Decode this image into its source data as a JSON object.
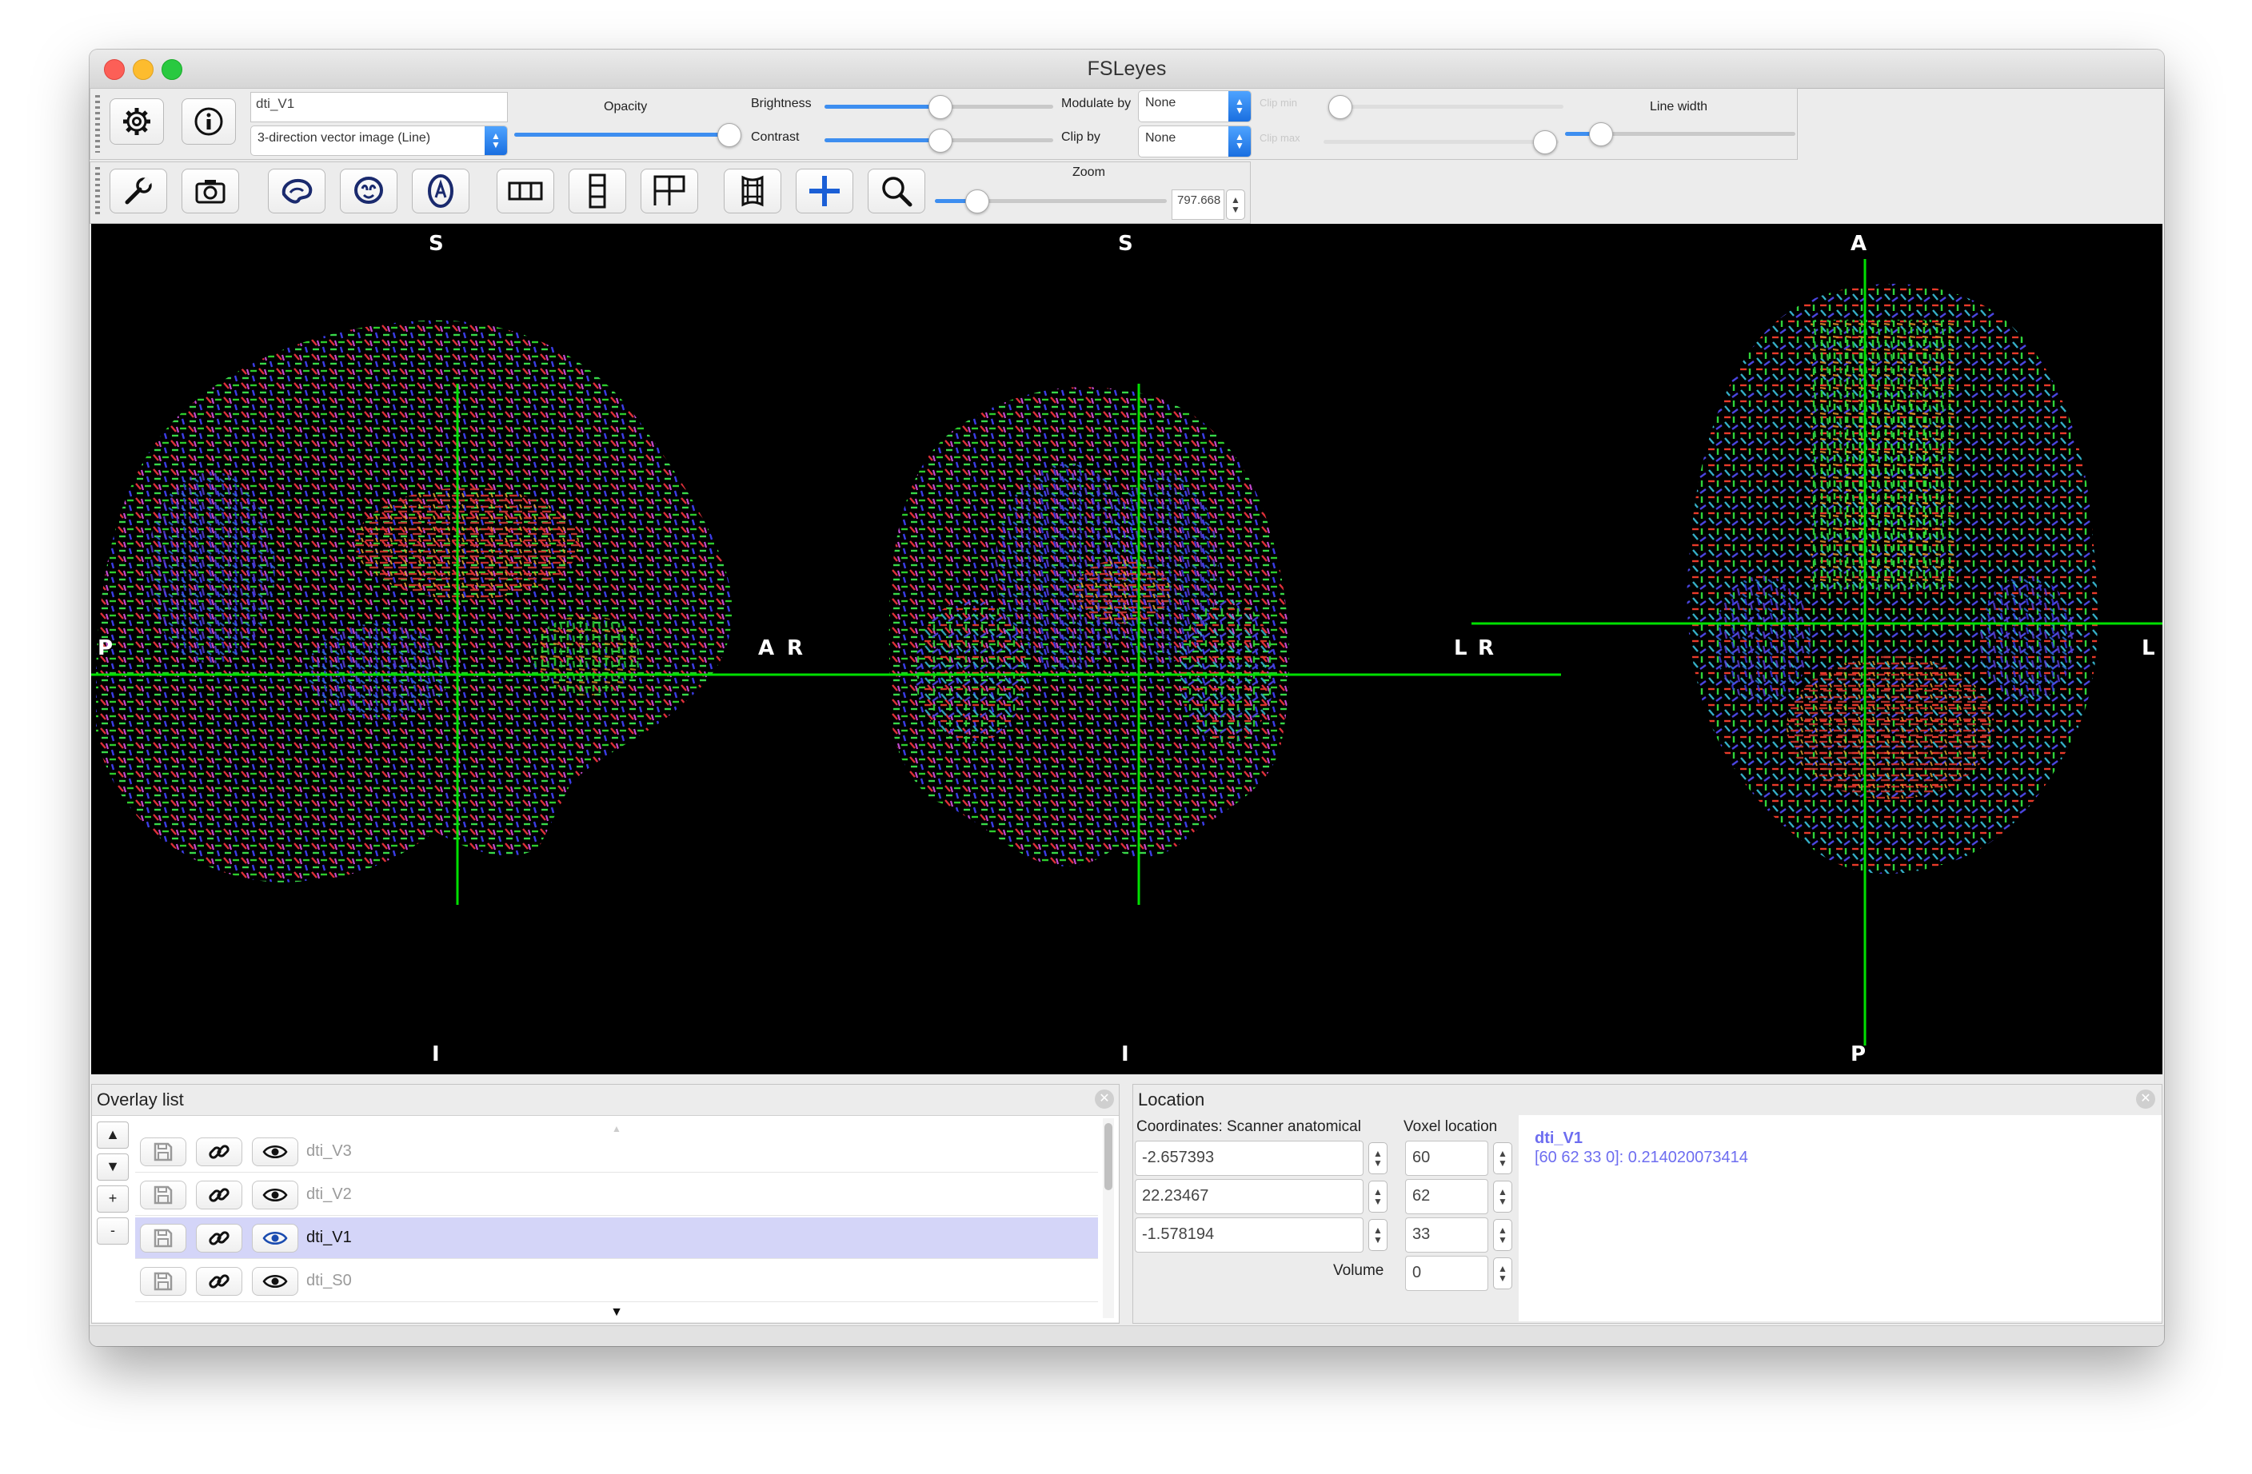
{
  "window": {
    "title": "FSLeyes"
  },
  "toolbar": {
    "overlay_name": "dti_V1",
    "display_type": "3-direction vector image (Line)",
    "opacity_label": "Opacity",
    "opacity_value": 0.95,
    "brightness_label": "Brightness",
    "brightness_value": 0.5,
    "contrast_label": "Contrast",
    "contrast_value": 0.5,
    "modulate_label": "Modulate by",
    "modulate_value": "None",
    "clip_label": "Clip by",
    "clip_value": "None",
    "clip_min_label": "Clip min",
    "clip_max_label": "Clip max",
    "line_width_label": "Line width",
    "line_width_value": 0.15,
    "zoom_label": "Zoom",
    "zoom_value": "797.668",
    "icons": [
      "gear-icon",
      "info-icon",
      "wrench-icon",
      "camera-icon",
      "sagittal-brain-icon",
      "coronal-brain-icon",
      "axial-brain-icon",
      "layout-horizontal-icon",
      "layout-vertical-icon",
      "layout-grid-icon",
      "movie-icon",
      "crosshair-icon",
      "zoom-icon"
    ]
  },
  "view": {
    "sagittal": {
      "top": "S",
      "bottom": "I",
      "left": "P",
      "right": "A"
    },
    "coronal": {
      "top": "S",
      "bottom": "I",
      "left": "R",
      "right": "L"
    },
    "axial": {
      "top": "A",
      "bottom": "P",
      "left": "R",
      "right": "L"
    },
    "cursor_color": "#00e000"
  },
  "overlay_list": {
    "title": "Overlay list",
    "controls": [
      "▲",
      "▼",
      "+",
      "-"
    ],
    "items": [
      {
        "name": "dti_V3",
        "selected": false
      },
      {
        "name": "dti_V2",
        "selected": false
      },
      {
        "name": "dti_V1",
        "selected": true
      },
      {
        "name": "dti_S0",
        "selected": false
      }
    ]
  },
  "location": {
    "title": "Location",
    "coords_label": "Coordinates: Scanner anatomical",
    "voxel_label": "Voxel location",
    "coords": [
      "-2.657393",
      "22.23467",
      "-1.578194"
    ],
    "voxels": [
      "60",
      "62",
      "33"
    ],
    "volume_label": "Volume",
    "volume_value": "0",
    "info_name": "dti_V1",
    "info_value": "[60 62 33 0]: 0.214020073414",
    "info_color": "#6d6df0"
  }
}
